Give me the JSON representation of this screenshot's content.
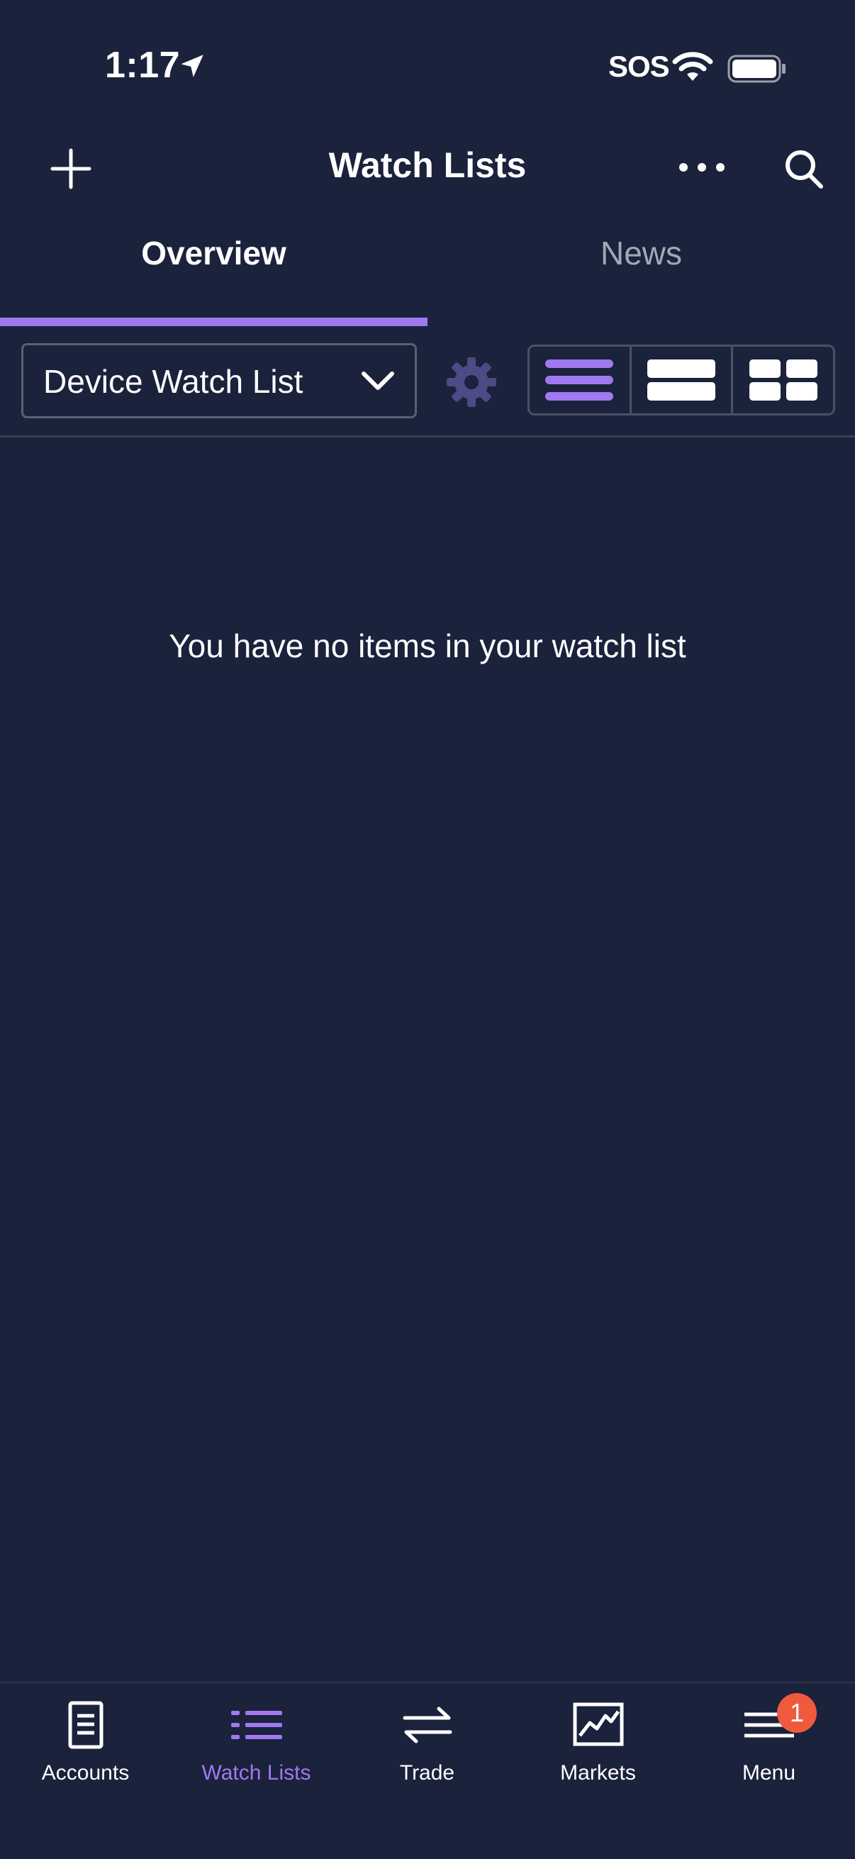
{
  "status_bar": {
    "time": "1:17",
    "carrier": "SOS"
  },
  "header": {
    "title": "Watch Lists"
  },
  "tabs": [
    {
      "label": "Overview",
      "active": true
    },
    {
      "label": "News",
      "active": false
    }
  ],
  "toolbar": {
    "watch_list_select": "Device Watch List",
    "view_modes": [
      "list-compact",
      "list-large",
      "grid"
    ],
    "active_view": "list-compact"
  },
  "empty_state": {
    "message": "You have no items in your watch list"
  },
  "bottom_nav": {
    "items": [
      {
        "label": "Accounts",
        "icon": "document-icon"
      },
      {
        "label": "Watch Lists",
        "icon": "list-icon",
        "active": true
      },
      {
        "label": "Trade",
        "icon": "swap-arrows-icon"
      },
      {
        "label": "Markets",
        "icon": "chart-icon"
      },
      {
        "label": "Menu",
        "icon": "hamburger-icon",
        "badge": "1"
      }
    ]
  },
  "colors": {
    "background": "#1b223b",
    "accent": "#a078f0",
    "badge": "#f05a3c",
    "muted_text": "#a3a8b7"
  }
}
